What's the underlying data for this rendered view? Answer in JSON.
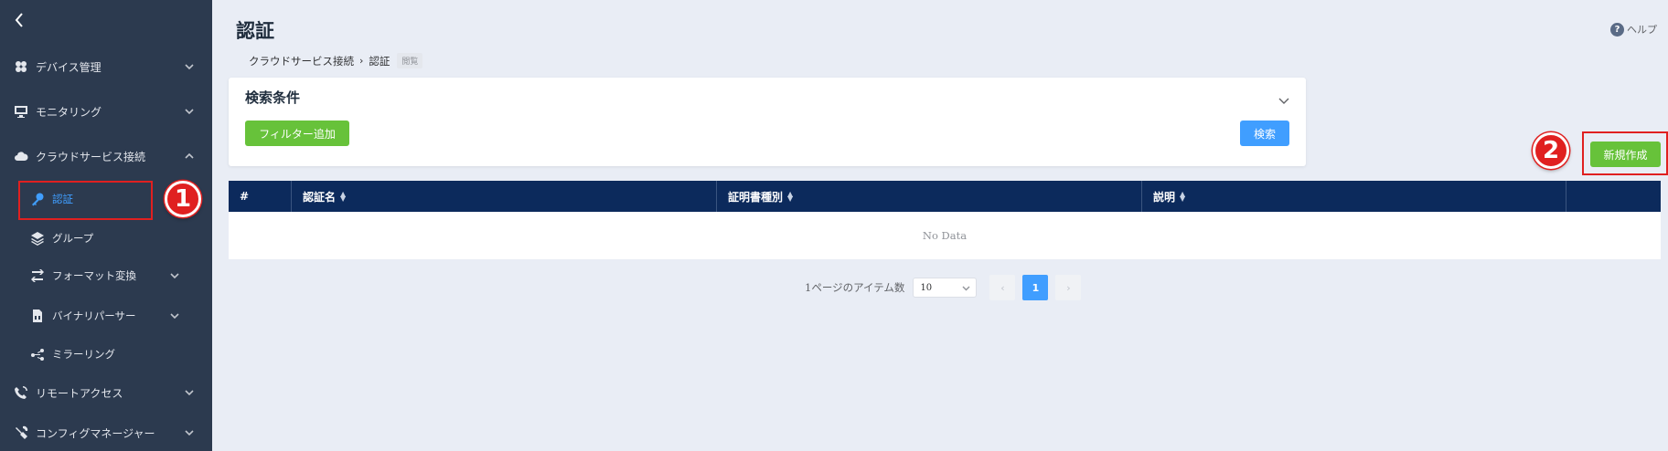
{
  "page": {
    "title": "認証",
    "help": "ヘルプ"
  },
  "breadcrumb": {
    "items": [
      "クラウドサービス接続",
      "認証"
    ],
    "tag": "閲覧"
  },
  "sidebar": {
    "items": [
      {
        "label": "デバイス管理",
        "icon": "devices-icon"
      },
      {
        "label": "モニタリング",
        "icon": "monitor-icon"
      },
      {
        "label": "クラウドサービス接続",
        "icon": "cloud-icon"
      },
      {
        "label": "認証",
        "icon": "key-icon"
      },
      {
        "label": "グループ",
        "icon": "layers-icon"
      },
      {
        "label": "フォーマット変換",
        "icon": "convert-icon"
      },
      {
        "label": "バイナリパーサー",
        "icon": "file-icon"
      },
      {
        "label": "ミラーリング",
        "icon": "share-icon"
      },
      {
        "label": "リモートアクセス",
        "icon": "remote-icon"
      },
      {
        "label": "コンフィグマネージャー",
        "icon": "tools-icon"
      }
    ]
  },
  "search": {
    "title": "検索条件",
    "add_filter": "フィルター追加",
    "search_button": "検索"
  },
  "create_button": "新規作成",
  "annotations": {
    "one": "1",
    "two": "2"
  },
  "table": {
    "columns": [
      "#",
      "認証名",
      "証明書種別",
      "説明",
      ""
    ],
    "empty_text": "No Data"
  },
  "pagination": {
    "items_per_page_label": "1ページのアイテム数",
    "page_size": "10",
    "current_page": "1"
  },
  "colors": {
    "sidebar_bg": "#2c3a4f",
    "table_header_bg": "#0c2a5c",
    "accent_blue": "#409eff",
    "accent_green": "#67c23a",
    "annotation_red": "#e02020"
  }
}
